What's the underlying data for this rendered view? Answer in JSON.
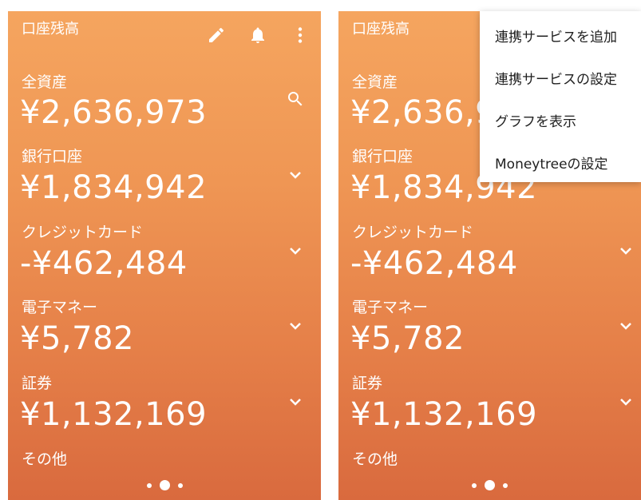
{
  "screen_title": "口座残高",
  "categories": [
    {
      "label": "全資産",
      "amount": "¥2,636,973"
    },
    {
      "label": "銀行口座",
      "amount": "¥1,834,942"
    },
    {
      "label": "クレジットカード",
      "amount": "-¥462,484"
    },
    {
      "label": "電子マネー",
      "amount": "¥5,782"
    },
    {
      "label": "証券",
      "amount": "¥1,132,169"
    },
    {
      "label": "その他"
    }
  ],
  "toolbar_icons": [
    "edit-icon",
    "bell-icon",
    "more-vert-icon"
  ],
  "overflow_menu": {
    "items": [
      "連携サービスを追加",
      "連携サービスの設定",
      "グラフを表示",
      "Moneytreeの設定"
    ]
  },
  "page_indicator": {
    "count": 3,
    "active_index": 1
  },
  "colors": {
    "gradient_top": "#f5a55f",
    "gradient_bottom": "#d96a3e",
    "text": "#ffffff",
    "menu_text": "#212121"
  }
}
